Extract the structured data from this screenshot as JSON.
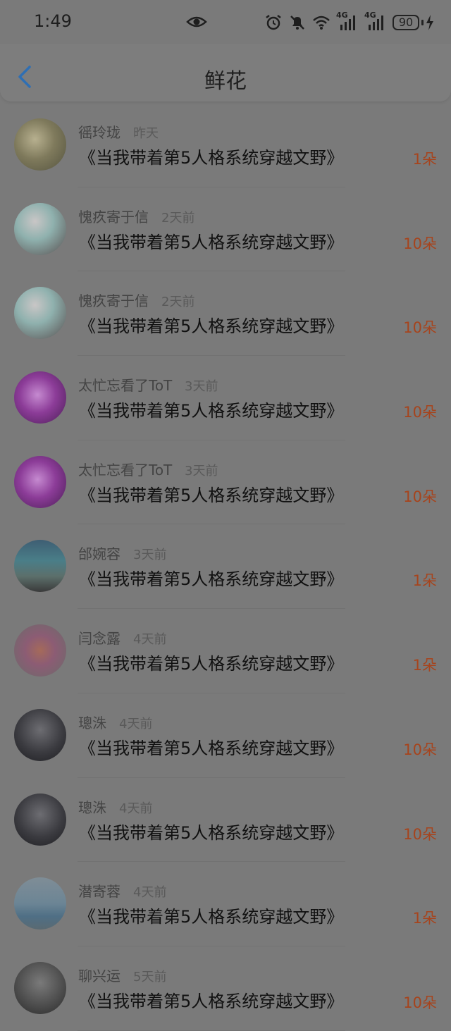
{
  "status_bar": {
    "time": "1:49",
    "network1": "4G",
    "network2": "4G",
    "battery": "90"
  },
  "header": {
    "title": "鲜花"
  },
  "colors": {
    "accent_count": "#a6441d",
    "back_arrow": "#2f6fb3"
  },
  "records": [
    {
      "name": "徭玲珑",
      "time": "昨天",
      "book": "《当我带着第5人格系统穿越文野》",
      "count": "1朵",
      "avatar": "landscape-photo"
    },
    {
      "name": "愧疚寄于信",
      "time": "2天前",
      "book": "《当我带着第5人格系统穿越文野》",
      "count": "10朵",
      "avatar": "anime-teal-hair"
    },
    {
      "name": "愧疚寄于信",
      "time": "2天前",
      "book": "《当我带着第5人格系统穿越文野》",
      "count": "10朵",
      "avatar": "anime-teal-hair"
    },
    {
      "name": "太忙忘看了ToT",
      "time": "3天前",
      "book": "《当我带着第5人格系统穿越文野》",
      "count": "10朵",
      "avatar": "anime-purple"
    },
    {
      "name": "太忙忘看了ToT",
      "time": "3天前",
      "book": "《当我带着第5人格系统穿越文野》",
      "count": "10朵",
      "avatar": "anime-purple"
    },
    {
      "name": "邰婉容",
      "time": "3天前",
      "book": "《当我带着第5人格系统穿越文野》",
      "count": "1朵",
      "avatar": "street-photo"
    },
    {
      "name": "闫念露",
      "time": "4天前",
      "book": "《当我带着第5人格系统穿越文野》",
      "count": "1朵",
      "avatar": "person-balloon"
    },
    {
      "name": "璁洙",
      "time": "4天前",
      "book": "《当我带着第5人格系统穿越文野》",
      "count": "10朵",
      "avatar": "anime-dark"
    },
    {
      "name": "璁洙",
      "time": "4天前",
      "book": "《当我带着第5人格系统穿越文野》",
      "count": "10朵",
      "avatar": "anime-dark"
    },
    {
      "name": "潜寄蓉",
      "time": "4天前",
      "book": "《当我带着第5人格系统穿越文野》",
      "count": "1朵",
      "avatar": "sea-photo"
    },
    {
      "name": "聊兴运",
      "time": "5天前",
      "book": "《当我带着第5人格系统穿越文野》",
      "count": "10朵",
      "avatar": "portrait-photo"
    }
  ]
}
